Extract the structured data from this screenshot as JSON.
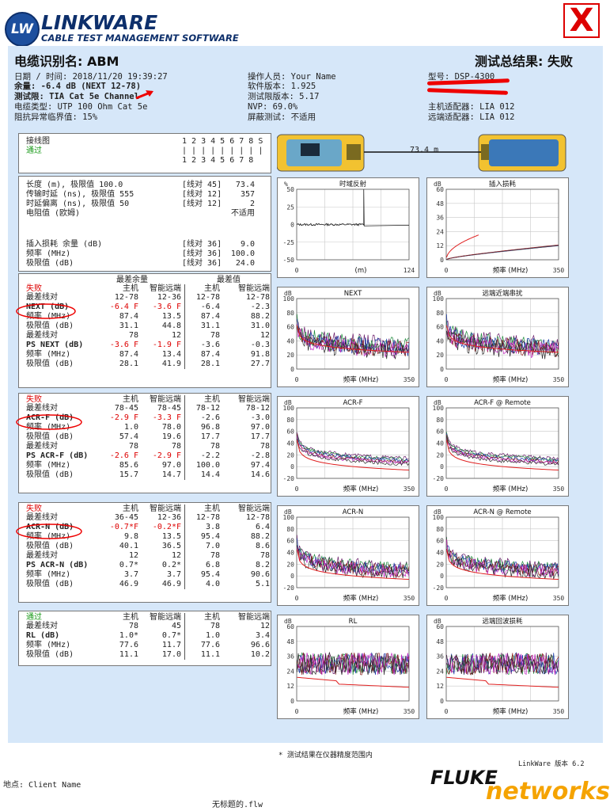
{
  "header": {
    "badge": "LW",
    "brand": "LINKWARE",
    "subtitle": "CABLE TEST MANAGEMENT SOFTWARE",
    "fail_mark": "X"
  },
  "report": {
    "cable_id": "电缆识别名: ABM",
    "overall": "测试总结果: 失败",
    "date": "日期 / 时间: 2018/11/20 19:39:27",
    "headroom": "余量: -6.4 dB (NEXT 12-78)",
    "limit": "测试限: TIA Cat 5e Channel",
    "cable_type": "电缆类型: UTP 100 Ohm Cat 5e",
    "impedance": "阻抗异常临界值: 15%",
    "operator": "操作人员: Your Name",
    "software": "软件版本: 1.925",
    "limit_version": "测试限版本: 5.17",
    "nvp": "NVP: 69.0%",
    "shield": "屏蔽测试: 不适用",
    "model": "型号: DSP-4300",
    "main_adapter": "主机适配器: LIA 012",
    "remote_adapter": "远端适配器: LIA 012"
  },
  "wiremap": {
    "label": "接线图",
    "status": "通过",
    "top": "1 2 3 4 5 6 7 8 S",
    "mid": "| | | | | | | | |",
    "bottom": "1 2 3 4 5 6 7 8"
  },
  "device": {
    "length": "73.4 m"
  },
  "summary": {
    "rows": [
      {
        "label": "长度 (m), 极限值 100.0",
        "pair": "[线对 45]",
        "value": "73.4"
      },
      {
        "label": "传输时延 (ns), 极限值 555",
        "pair": "[线对 12]",
        "value": "357"
      },
      {
        "label": "时延偏离 (ns), 极限值 50",
        "pair": "[线对 12]",
        "value": "2"
      },
      {
        "label": "电阻值 (欧姆)",
        "pair": "",
        "value": "不适用"
      },
      {
        "label": "插入损耗 余量 (dB)",
        "pair": "[线对 36]",
        "value": "9.0"
      },
      {
        "label": "频率 (MHz)",
        "pair": "[线对 36]",
        "value": "100.0"
      },
      {
        "label": "极限值 (dB)",
        "pair": "[线对 36]",
        "value": "24.0"
      }
    ]
  },
  "groups": [
    {
      "status": "失败",
      "status_color": "#dd0000",
      "super_left": "最差余量",
      "super_right": "最差值",
      "col_main": "主机",
      "col_remote": "智能远端",
      "rows": [
        {
          "label": "最差线对",
          "v": [
            "12-78",
            "12-36",
            "12-78",
            "12-78"
          ]
        },
        {
          "label": "NEXT (dB)",
          "bold": true,
          "v": [
            "-6.4 F",
            "-3.6 F",
            "-6.4",
            "-2.3"
          ],
          "red": [
            true,
            true,
            false,
            false
          ]
        },
        {
          "label": "频率 (MHz)",
          "v": [
            "87.4",
            "13.5",
            "87.4",
            "88.2"
          ]
        },
        {
          "label": "极限值 (dB)",
          "v": [
            "31.1",
            "44.8",
            "31.1",
            "31.0"
          ]
        },
        {
          "label": "最差线对",
          "v": [
            "78",
            "12",
            "78",
            "12"
          ]
        },
        {
          "label": "PS NEXT (dB)",
          "bold": true,
          "v": [
            "-3.6 F",
            "-1.9 F",
            "-3.6",
            "-0.3"
          ],
          "red": [
            true,
            true,
            false,
            false
          ]
        },
        {
          "label": "频率 (MHz)",
          "v": [
            "87.4",
            "13.4",
            "87.4",
            "91.8"
          ]
        },
        {
          "label": "极限值 (dB)",
          "v": [
            "28.1",
            "41.9",
            "28.1",
            "27.7"
          ]
        }
      ]
    },
    {
      "status": "失败",
      "status_color": "#dd0000",
      "col_main": "主机",
      "col_remote": "智能远端",
      "rows": [
        {
          "label": "最差线对",
          "v": [
            "78-45",
            "78-45",
            "78-12",
            "78-12"
          ]
        },
        {
          "label": "ACR-F (dB)",
          "bold": true,
          "v": [
            "-2.9 F",
            "-3.3 F",
            "-2.6",
            "-3.0"
          ],
          "red": [
            true,
            true,
            false,
            false
          ]
        },
        {
          "label": "频率 (MHz)",
          "v": [
            "1.0",
            "78.0",
            "96.8",
            "97.0"
          ]
        },
        {
          "label": "极限值 (dB)",
          "v": [
            "57.4",
            "19.6",
            "17.7",
            "17.7"
          ]
        },
        {
          "label": "最差线对",
          "v": [
            "78",
            "78",
            "78",
            "78"
          ]
        },
        {
          "label": "PS ACR-F (dB)",
          "bold": true,
          "v": [
            "-2.6 F",
            "-2.9 F",
            "-2.2",
            "-2.8"
          ],
          "red": [
            true,
            true,
            false,
            false
          ]
        },
        {
          "label": "频率 (MHz)",
          "v": [
            "85.6",
            "97.0",
            "100.0",
            "97.4"
          ]
        },
        {
          "label": "极限值 (dB)",
          "v": [
            "15.7",
            "14.7",
            "14.4",
            "14.6"
          ]
        }
      ]
    },
    {
      "status": "失败",
      "status_color": "#dd0000",
      "col_main": "主机",
      "col_remote": "智能远端",
      "rows": [
        {
          "label": "最差线对",
          "v": [
            "36-45",
            "12-36",
            "12-78",
            "12-78"
          ]
        },
        {
          "label": "ACR-N (dB)",
          "bold": true,
          "v": [
            "-0.7*F",
            "-0.2*F",
            "3.8",
            "6.4"
          ],
          "red": [
            true,
            true,
            false,
            false
          ]
        },
        {
          "label": "频率 (MHz)",
          "v": [
            "9.8",
            "13.5",
            "95.4",
            "88.2"
          ]
        },
        {
          "label": "极限值 (dB)",
          "v": [
            "40.1",
            "36.5",
            "7.0",
            "8.6"
          ]
        },
        {
          "label": "最差线对",
          "v": [
            "12",
            "12",
            "78",
            "78"
          ]
        },
        {
          "label": "PS ACR-N (dB)",
          "bold": true,
          "v": [
            "0.7*",
            "0.2*",
            "6.8",
            "8.2"
          ]
        },
        {
          "label": "频率 (MHz)",
          "v": [
            "3.7",
            "3.7",
            "95.4",
            "90.6"
          ]
        },
        {
          "label": "极限值 (dB)",
          "v": [
            "46.9",
            "46.9",
            "4.0",
            "5.1"
          ]
        }
      ]
    },
    {
      "status": "通过",
      "status_color": "#1a9a1a",
      "col_main": "主机",
      "col_remote": "智能远端",
      "rows": [
        {
          "label": "最差线对",
          "v": [
            "78",
            "45",
            "78",
            "12"
          ]
        },
        {
          "label": "RL (dB)",
          "bold": true,
          "v": [
            "1.0*",
            "0.7*",
            "1.0",
            "3.4"
          ]
        },
        {
          "label": "频率 (MHz)",
          "v": [
            "77.6",
            "11.7",
            "77.6",
            "96.6"
          ]
        },
        {
          "label": "极限值 (dB)",
          "v": [
            "11.1",
            "17.0",
            "11.1",
            "10.2"
          ]
        }
      ]
    }
  ],
  "chart_data": [
    {
      "type": "line",
      "title": "时域反射",
      "ylabel": "%",
      "xlabel": "(m)",
      "yticks": [
        "50",
        "25",
        "0",
        "-25",
        "-50"
      ],
      "xticks": [
        "0",
        "124"
      ],
      "ylim": [
        -50,
        50
      ],
      "xlim": [
        0,
        124
      ]
    },
    {
      "type": "line",
      "title": "插入损耗",
      "ylabel": "dB",
      "xlabel": "频率 (MHz)",
      "yticks": [
        "60",
        "48",
        "36",
        "24",
        "12",
        "0"
      ],
      "xticks": [
        "0",
        "350"
      ],
      "ylim": [
        0,
        60
      ],
      "xlim": [
        0,
        350
      ]
    },
    {
      "type": "line",
      "title": "NEXT",
      "ylabel": "dB",
      "xlabel": "频率 (MHz)",
      "yticks": [
        "100",
        "80",
        "60",
        "40",
        "20",
        "0"
      ],
      "xticks": [
        "0",
        "350"
      ],
      "ylim": [
        0,
        100
      ],
      "xlim": [
        0,
        350
      ]
    },
    {
      "type": "line",
      "title": "远端近端串扰",
      "ylabel": "dB",
      "xlabel": "频率 (MHz)",
      "yticks": [
        "100",
        "80",
        "60",
        "40",
        "20",
        "0"
      ],
      "xticks": [
        "0",
        "350"
      ],
      "ylim": [
        0,
        100
      ],
      "xlim": [
        0,
        350
      ]
    },
    {
      "type": "line",
      "title": "ACR-F",
      "ylabel": "dB",
      "xlabel": "频率 (MHz)",
      "yticks": [
        "100",
        "80",
        "60",
        "40",
        "20",
        "0",
        "-20"
      ],
      "xticks": [
        "0",
        "350"
      ],
      "ylim": [
        -20,
        100
      ],
      "xlim": [
        0,
        350
      ]
    },
    {
      "type": "line",
      "title": "ACR-F @ Remote",
      "ylabel": "dB",
      "xlabel": "频率 (MHz)",
      "yticks": [
        "100",
        "80",
        "60",
        "40",
        "20",
        "0",
        "-20"
      ],
      "xticks": [
        "0",
        "350"
      ],
      "ylim": [
        -20,
        100
      ],
      "xlim": [
        0,
        350
      ]
    },
    {
      "type": "line",
      "title": "ACR-N",
      "ylabel": "dB",
      "xlabel": "频率 (MHz)",
      "yticks": [
        "100",
        "80",
        "60",
        "40",
        "20",
        "0",
        "-20"
      ],
      "xticks": [
        "0",
        "350"
      ],
      "ylim": [
        -20,
        100
      ],
      "xlim": [
        0,
        350
      ]
    },
    {
      "type": "line",
      "title": "ACR-N @ Remote",
      "ylabel": "dB",
      "xlabel": "频率 (MHz)",
      "yticks": [
        "100",
        "80",
        "60",
        "40",
        "20",
        "0",
        "-20"
      ],
      "xticks": [
        "0",
        "350"
      ],
      "ylim": [
        -20,
        100
      ],
      "xlim": [
        0,
        350
      ]
    },
    {
      "type": "line",
      "title": "RL",
      "ylabel": "dB",
      "xlabel": "频率 (MHz)",
      "yticks": [
        "60",
        "48",
        "36",
        "24",
        "12",
        "0"
      ],
      "xticks": [
        "0",
        "350"
      ],
      "ylim": [
        0,
        60
      ],
      "xlim": [
        0,
        350
      ]
    },
    {
      "type": "line",
      "title": "远端回波损耗",
      "ylabel": "dB",
      "xlabel": "频率 (MHz)",
      "yticks": [
        "60",
        "48",
        "36",
        "24",
        "12",
        "0"
      ],
      "xticks": [
        "0",
        "350"
      ],
      "ylim": [
        0,
        60
      ],
      "xlim": [
        0,
        350
      ]
    }
  ],
  "footer": {
    "note": "* 测试结果在仪器精度范围内",
    "version": "LinkWare 版本  6.2",
    "location": "地点: Client Name",
    "filename": "无标题的.flw",
    "fluke": "FLUKE",
    "networks": "networks."
  },
  "colors": {
    "fail": "#dd0000",
    "pass": "#1a9a1a",
    "info_bg": "#d6e7f9",
    "brand": "#0d2f6b"
  }
}
